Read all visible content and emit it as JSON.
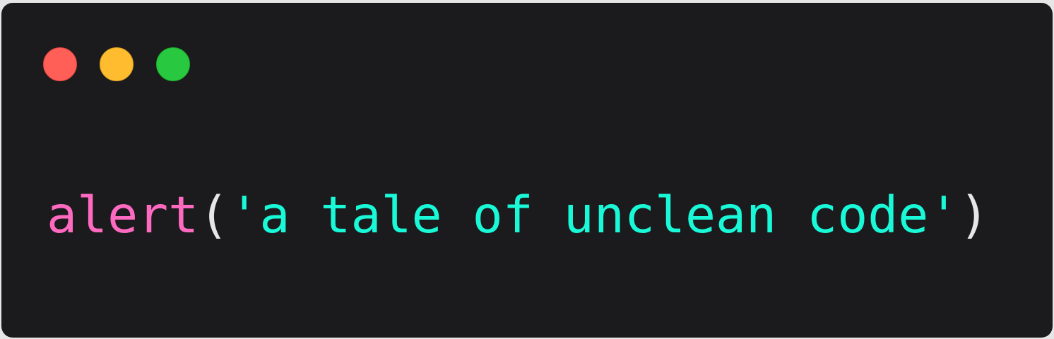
{
  "code": {
    "function": "alert",
    "open_paren": "(",
    "string": "'a tale of unclean code'",
    "close_paren": ")"
  },
  "colors": {
    "function": "#ff6ac1",
    "string": "#19f9d8",
    "punctuation": "#e6e6e6",
    "background": "#1b1b1d"
  }
}
